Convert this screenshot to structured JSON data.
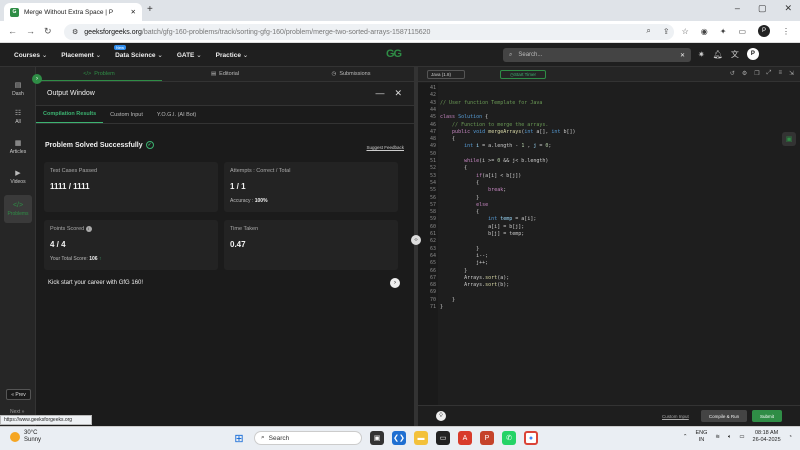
{
  "browser": {
    "tab_title": "Merge Without Extra Space | P",
    "url_domain": "geeksforgeeks.org",
    "url_path": "/batch/gfg-160-problems/track/sorting-gfg-160/problem/merge-two-sorted-arrays-1587115620",
    "avatar_letter": "P"
  },
  "gfg_header": {
    "menu": [
      "Courses",
      "Placement",
      "Data Science",
      "GATE",
      "Practice"
    ],
    "new_badge": "New",
    "logo": "GG",
    "search_placeholder": "Search...",
    "avatar_letter": "P"
  },
  "sidebar": {
    "items": [
      {
        "icon": "▤",
        "label": "Dash"
      },
      {
        "icon": "☷",
        "label": "All"
      },
      {
        "icon": "▦",
        "label": "Articles"
      },
      {
        "icon": "▶",
        "label": "Videos"
      },
      {
        "icon": "</>",
        "label": "Problems"
      }
    ],
    "prev_label": "« Prev",
    "next_label": "Next »"
  },
  "panel_tabs": [
    {
      "icon": "</>",
      "label": "Problem"
    },
    {
      "icon": "▤",
      "label": "Editorial"
    },
    {
      "icon": "◷",
      "label": "Submissions"
    }
  ],
  "output": {
    "title": "Output Window",
    "tabs": [
      "Compilation Results",
      "Custom Input",
      "Y.O.G.I. (AI Bot)"
    ],
    "status": "Problem Solved Successfully",
    "feedback": "Suggest Feedback",
    "cards": {
      "tests": {
        "label": "Test Cases Passed",
        "value": "1111 / 1111"
      },
      "attempts": {
        "label": "Attempts : Correct / Total",
        "value": "1 / 1",
        "sub_label": "Accuracy :",
        "sub_value": "100%"
      },
      "points": {
        "label": "Points Scored",
        "value": "4 / 4",
        "sub_label": "Your Total Score:",
        "sub_value": "106"
      },
      "time": {
        "label": "Time Taken",
        "value": "0.47"
      }
    },
    "kickstart": "Kick start your career with GfG 160!"
  },
  "editor": {
    "language": "Java (1.8)",
    "timer_label": "Start Timer",
    "footer": {
      "custom_input": "Custom Input",
      "compile": "Compile & Run",
      "submit": "Submit"
    },
    "lines": [
      {
        "n": "41",
        "html": ""
      },
      {
        "n": "42",
        "html": ""
      },
      {
        "n": "43",
        "html": "<span class='c'>// User function Template for Java</span>"
      },
      {
        "n": "44",
        "html": ""
      },
      {
        "n": "45",
        "html": "<span class='k'>class</span> <span class='t'>Solution</span> {"
      },
      {
        "n": "46",
        "html": "    <span class='c'>// Function to merge the arrays.</span>"
      },
      {
        "n": "47",
        "html": "    <span class='k'>public</span> <span class='t'>void</span> <span class='f'>mergeArrays</span>(<span class='t'>int</span> a[], <span class='t'>int</span> b[])"
      },
      {
        "n": "48",
        "html": "    {"
      },
      {
        "n": "49",
        "html": "        <span class='t'>int</span> <span class='v'>i</span> = a.length - <span class='n'>1</span> , <span class='v'>j</span> = <span class='n'>0</span>;"
      },
      {
        "n": "50",
        "html": ""
      },
      {
        "n": "51",
        "html": "        <span class='k'>while</span>(i >= <span class='n'>0</span> && j< b.length)"
      },
      {
        "n": "52",
        "html": "        {"
      },
      {
        "n": "53",
        "html": "            <span class='k'>if</span>(a[i] < b[j])"
      },
      {
        "n": "54",
        "html": "            {"
      },
      {
        "n": "55",
        "html": "                <span class='k'>break</span>;"
      },
      {
        "n": "56",
        "html": "            }"
      },
      {
        "n": "57",
        "html": "            <span class='k'>else</span>"
      },
      {
        "n": "58",
        "html": "            {"
      },
      {
        "n": "59",
        "html": "                <span class='t'>int</span> <span class='v'>temp</span> = a[i];"
      },
      {
        "n": "60",
        "html": "                a[i] = b[j];"
      },
      {
        "n": "61",
        "html": "                b[j] = temp;"
      },
      {
        "n": "62",
        "html": ""
      },
      {
        "n": "63",
        "html": "            }"
      },
      {
        "n": "64",
        "html": "            i--;"
      },
      {
        "n": "65",
        "html": "            j++;"
      },
      {
        "n": "66",
        "html": "        }"
      },
      {
        "n": "67",
        "html": "        Arrays.<span class='f'>sort</span>(a);"
      },
      {
        "n": "68",
        "html": "        Arrays.<span class='f'>sort</span>(b);"
      },
      {
        "n": "69",
        "html": ""
      },
      {
        "n": "70",
        "html": "    }"
      },
      {
        "n": "71",
        "html": "}"
      }
    ]
  },
  "status_hint": "https://www.geeksforgeeks.org",
  "taskbar": {
    "temp": "30°C",
    "weather": "Sunny",
    "search_label": "Search",
    "lang": "ENG",
    "region": "IN",
    "time": "08:18 AM",
    "date": "26-04-2025"
  }
}
